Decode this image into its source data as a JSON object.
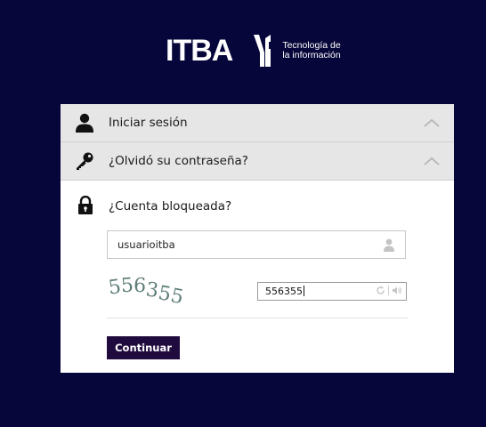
{
  "brand": {
    "name": "ITBA",
    "subtitle_line1": "Tecnología de",
    "subtitle_line2": "la información"
  },
  "accordion": {
    "items": [
      {
        "label": "Iniciar sesión",
        "icon": "user-icon"
      },
      {
        "label": "¿Olvidó su contraseña?",
        "icon": "key-icon"
      }
    ],
    "open": {
      "label": "¿Cuenta bloqueada?",
      "icon": "lock-icon"
    }
  },
  "form": {
    "username_value": "usuarioitba",
    "captcha_image_text": "556355",
    "captcha_value": "556355",
    "submit_label": "Continuar"
  },
  "colors": {
    "background": "#07063a",
    "button": "#200b3e",
    "header_row": "#e6e6e6"
  }
}
